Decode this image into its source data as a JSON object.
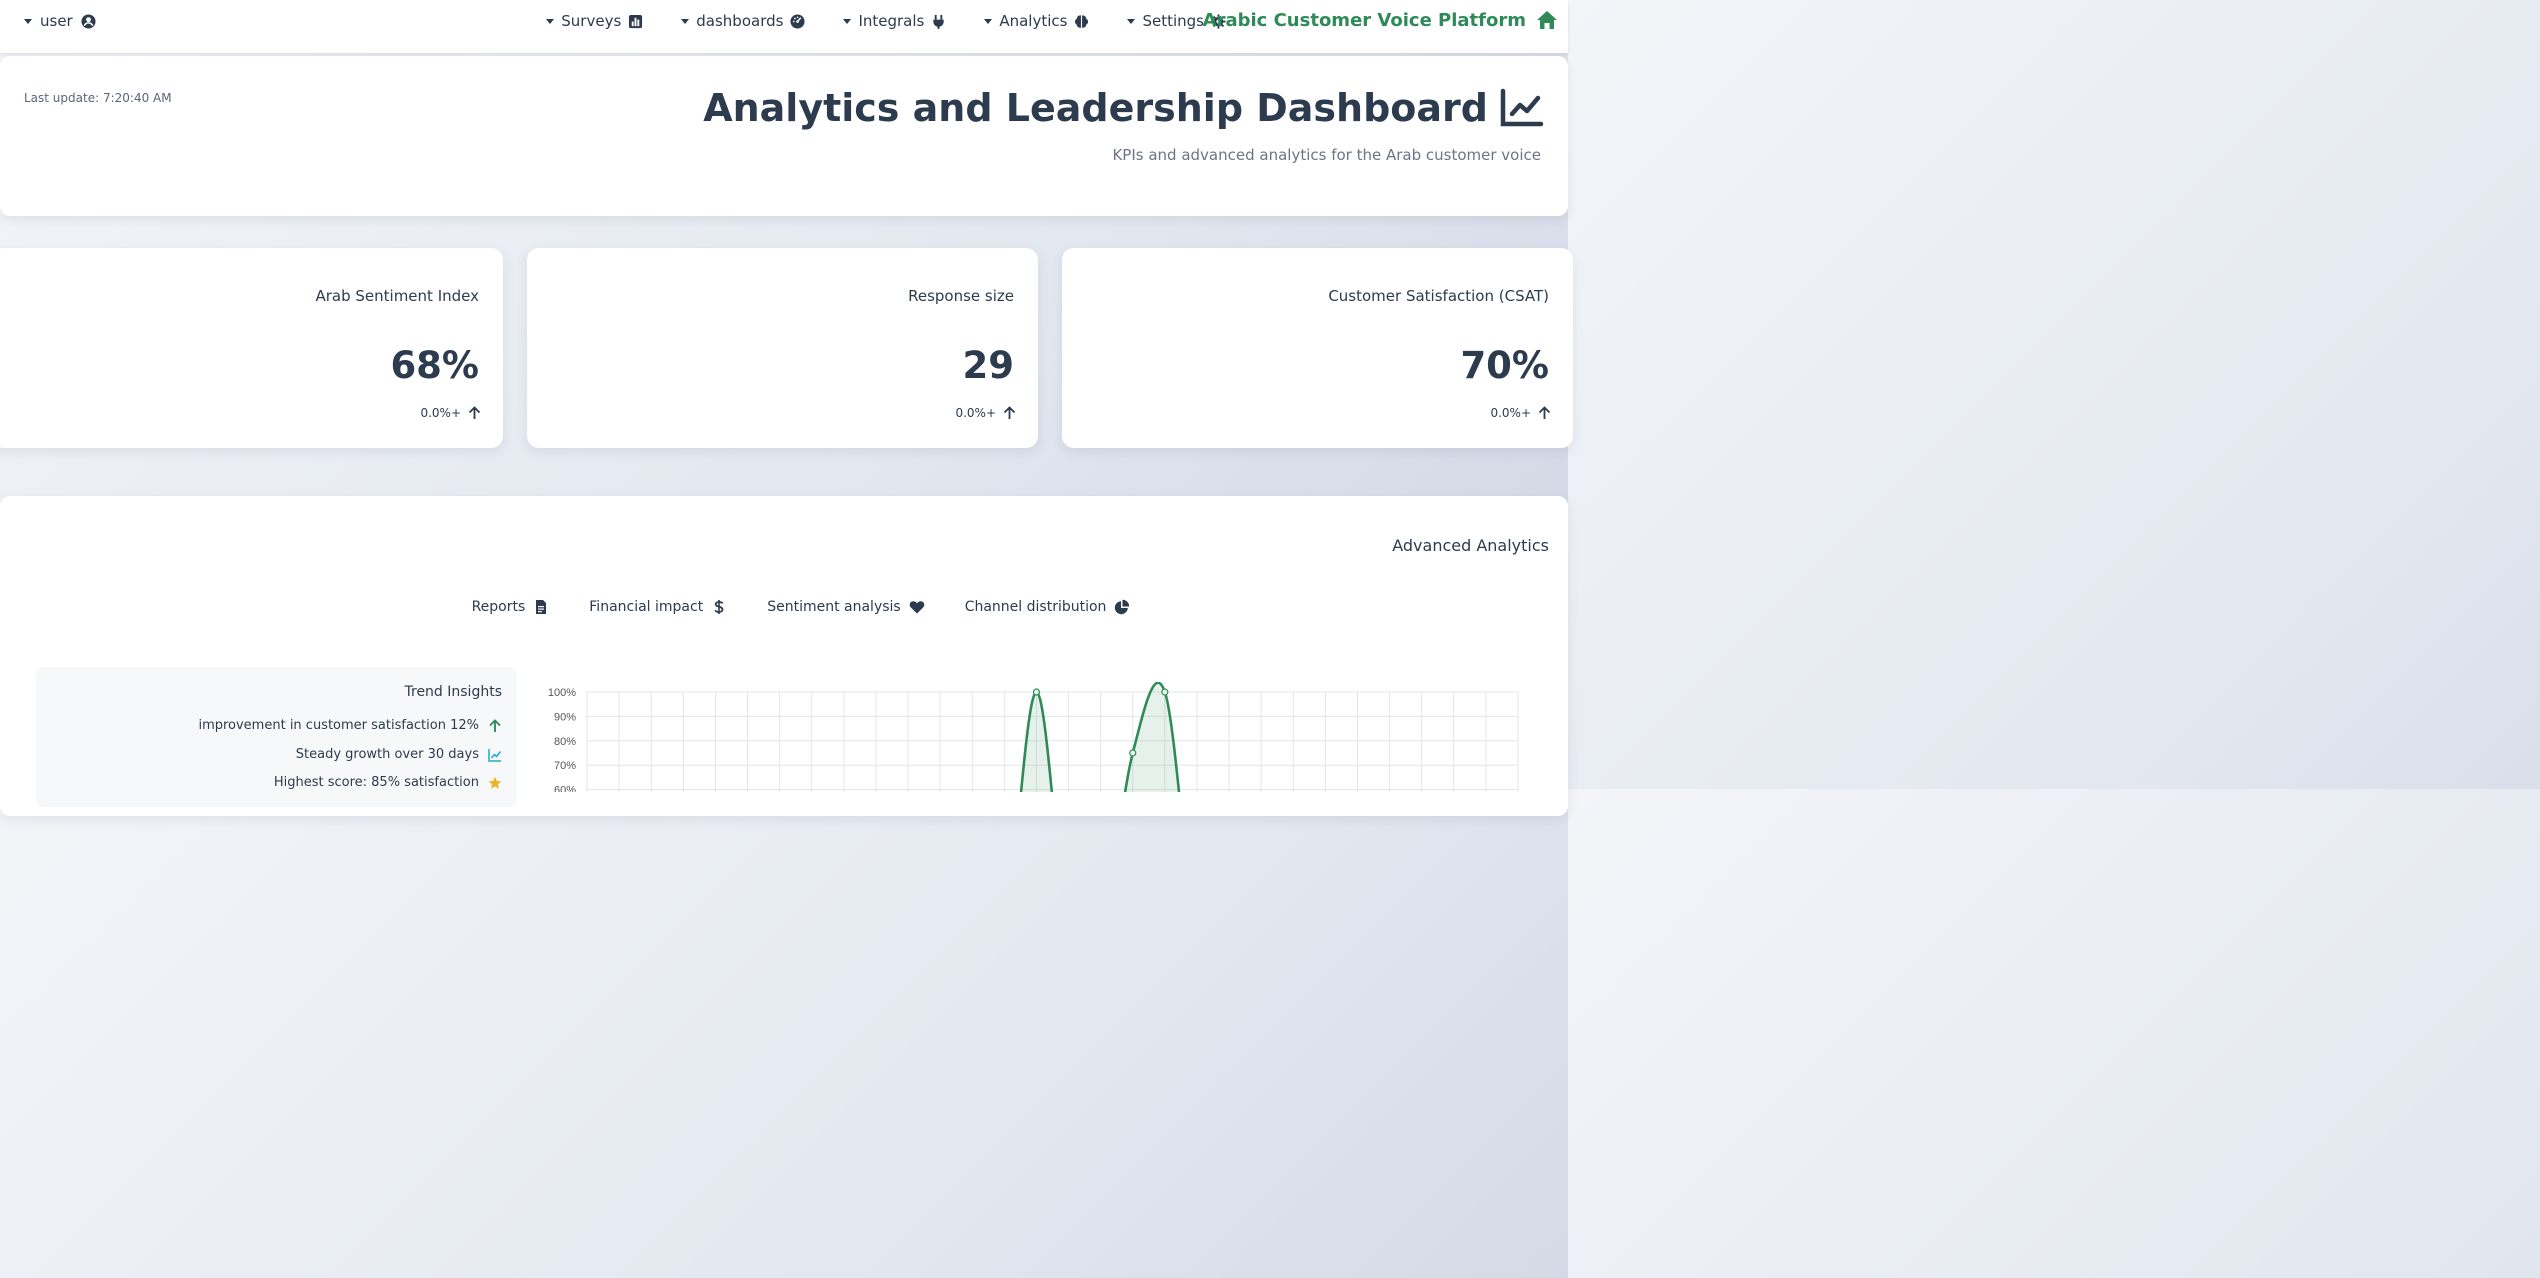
{
  "nav": {
    "user_label": "user",
    "menu": [
      {
        "label": "Surveys",
        "icon": "chart-bar-icon"
      },
      {
        "label": "dashboards",
        "icon": "gauge-icon"
      },
      {
        "label": "Integrals",
        "icon": "plug-icon"
      },
      {
        "label": "Analytics",
        "icon": "brain-icon"
      },
      {
        "label": "Settings",
        "icon": "gear-icon"
      }
    ],
    "brand": "Arabic Customer Voice Platform",
    "brand_color": "#2e8b57"
  },
  "header": {
    "last_update": "Last update: 7:20:40 AM",
    "title": "Analytics and Leadership Dashboard",
    "subtitle": "KPIs and advanced analytics for the Arab customer voice"
  },
  "kpis": [
    {
      "title": "Arab Sentiment Index",
      "value": "68%",
      "change": "0.0%+"
    },
    {
      "title": "Response size",
      "value": "29",
      "change": "0.0%+"
    },
    {
      "title": "Customer Satisfaction (CSAT)",
      "value": "70%",
      "change": "0.0%+"
    }
  ],
  "advanced": {
    "title": "Advanced Analytics",
    "tabs": [
      {
        "label": "Reports",
        "icon": "file-icon"
      },
      {
        "label": "Financial impact",
        "icon": "dollar-icon"
      },
      {
        "label": "Sentiment analysis",
        "icon": "heart-icon"
      },
      {
        "label": "Channel distribution",
        "icon": "pie-chart-icon"
      }
    ],
    "insights_title": "Trend Insights",
    "insights": [
      {
        "text": "improvement in customer satisfaction 12%",
        "icon": "arrow-up-icon",
        "color": "#2e8b57"
      },
      {
        "text": "Steady growth over 30 days",
        "icon": "line-chart-icon",
        "color": "#1ab0c8"
      },
      {
        "text": "Highest score: 85% satisfaction",
        "icon": "star-icon",
        "color": "#f0b429"
      }
    ]
  },
  "chart_data": {
    "type": "area",
    "y_ticks": [
      "100%",
      "90%",
      "80%",
      "70%",
      "60%"
    ],
    "ylim": [
      0,
      100
    ],
    "x": [
      0,
      1,
      2,
      3,
      4,
      5,
      6,
      7,
      8,
      9,
      10,
      11,
      12,
      13,
      14,
      15,
      16,
      17,
      18,
      19,
      20,
      21,
      22,
      23,
      24,
      25,
      26,
      27,
      28,
      29
    ],
    "values": [
      0,
      0,
      0,
      0,
      0,
      0,
      0,
      0,
      0,
      0,
      0,
      0,
      0,
      0,
      100,
      0,
      0,
      75,
      100,
      0,
      0,
      0,
      0,
      0,
      0,
      0,
      0,
      0,
      0,
      0
    ],
    "line_color": "#2e8b57",
    "grid": true
  }
}
